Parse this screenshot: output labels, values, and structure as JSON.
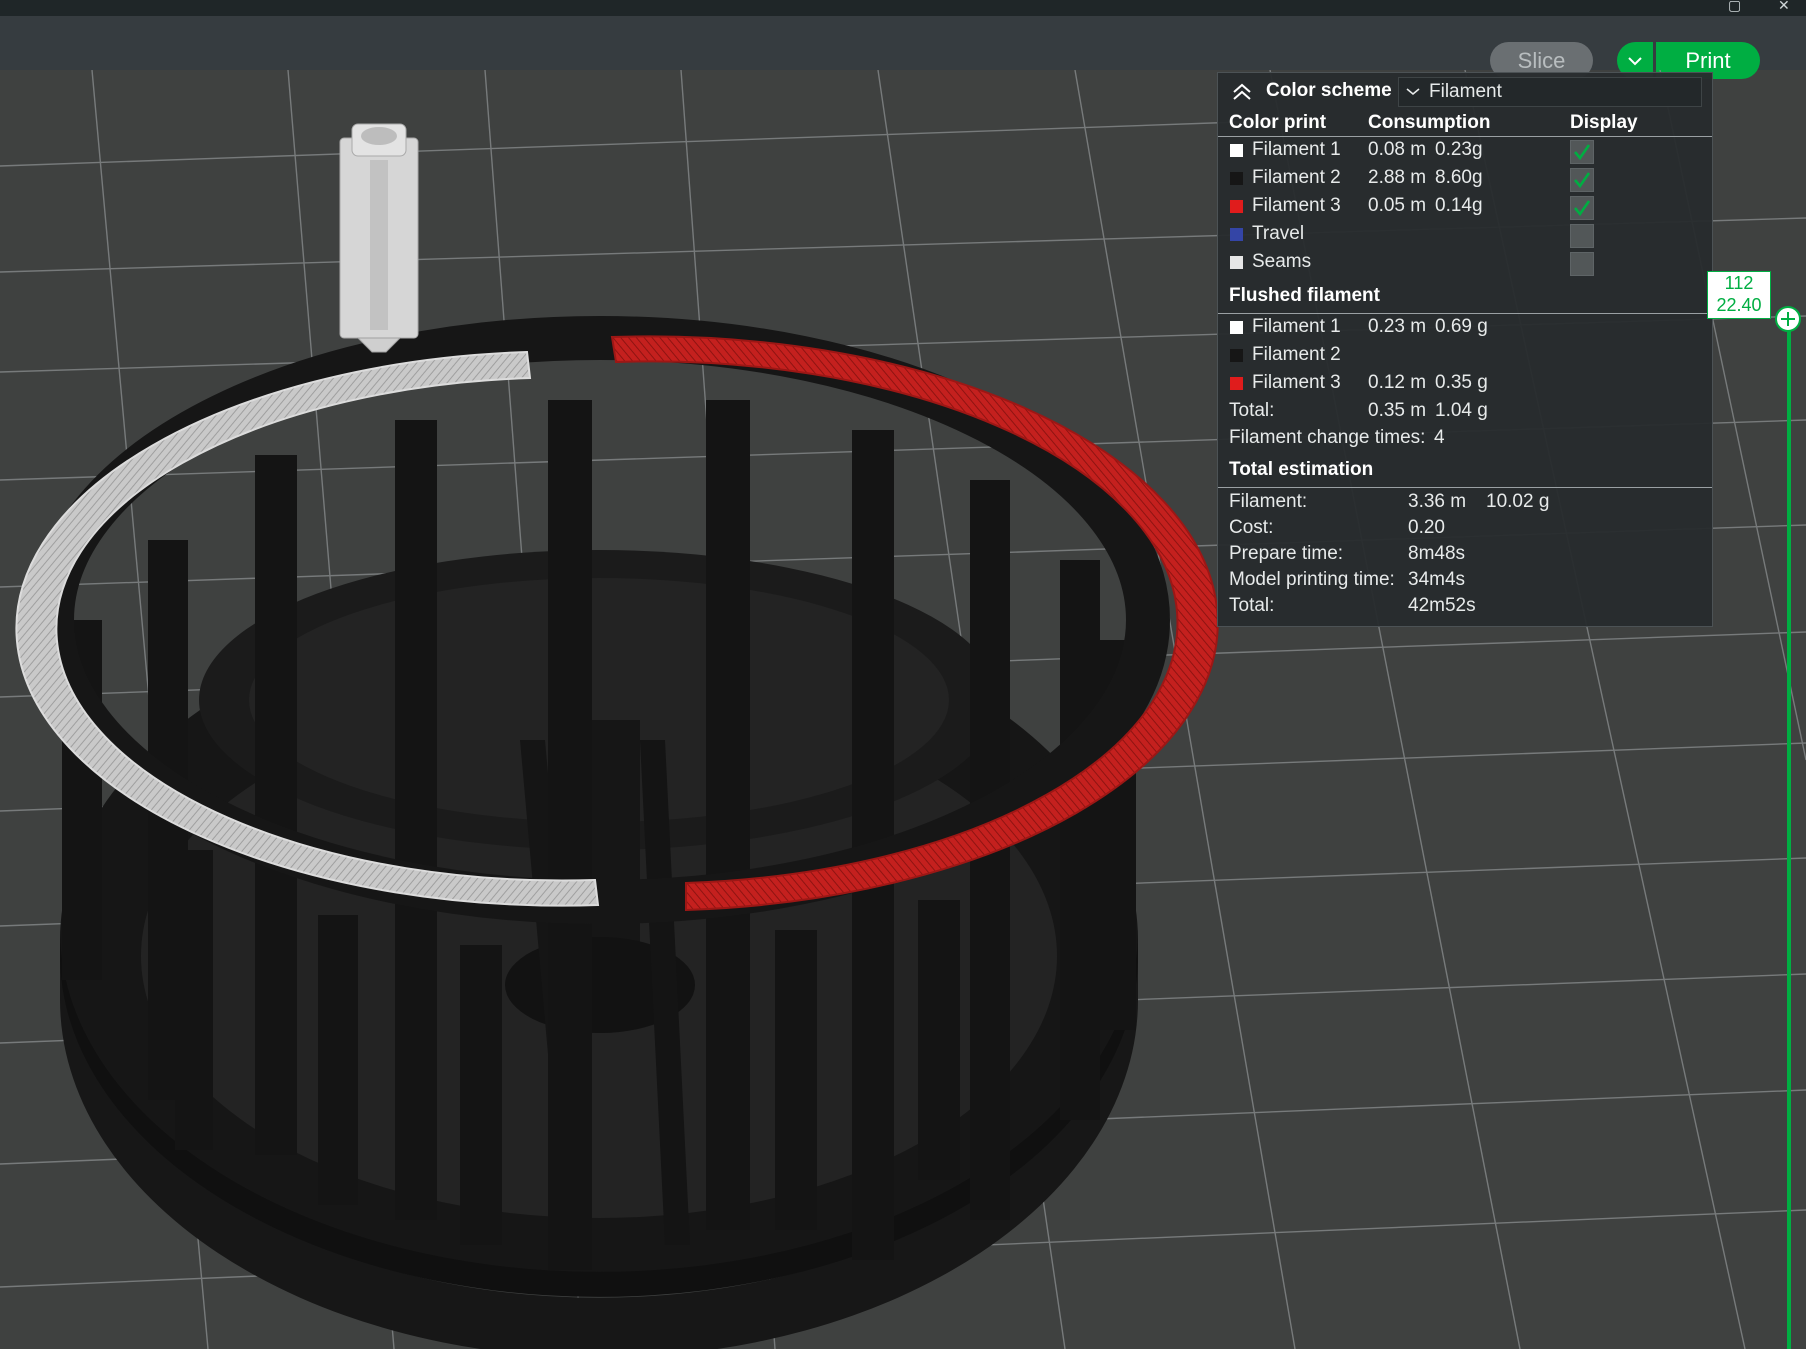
{
  "toolbar": {
    "slice_label": "Slice",
    "print_label": "Print",
    "print_dropdown_icon": "chevron-down-icon",
    "accent_color": "#00ae42"
  },
  "legend": {
    "collapse_icon": "double-chevron-up-icon",
    "title": "Color scheme",
    "scheme_value": "Filament",
    "columns": {
      "color_print": "Color print",
      "consumption": "Consumption",
      "display": "Display"
    },
    "color_print_items": [
      {
        "label": "Filament 1",
        "length": "0.08 m",
        "weight": "0.23g",
        "color": "#ffffff",
        "display": true
      },
      {
        "label": "Filament 2",
        "length": "2.88 m",
        "weight": "8.60g",
        "color": "#161616",
        "display": true
      },
      {
        "label": "Filament 3",
        "length": "0.05 m",
        "weight": "0.14g",
        "color": "#e01c1c",
        "display": true
      },
      {
        "label": "Travel",
        "length": "",
        "weight": "",
        "color": "#3445a6",
        "display": false
      },
      {
        "label": "Seams",
        "length": "",
        "weight": "",
        "color": "#e6e6e6",
        "display": false
      }
    ],
    "flushed": {
      "title": "Flushed filament",
      "items": [
        {
          "label": "Filament 1",
          "length": "0.23 m",
          "weight": "0.69 g",
          "color": "#ffffff"
        },
        {
          "label": "Filament 2",
          "length": "",
          "weight": "",
          "color": "#161616"
        },
        {
          "label": "Filament 3",
          "length": "0.12 m",
          "weight": "0.35 g",
          "color": "#e01c1c"
        }
      ],
      "total_label": "Total:",
      "total_length": "0.35 m",
      "total_weight": "1.04 g",
      "change_times_label": "Filament change times:",
      "change_times_value": "4"
    },
    "estimation": {
      "title": "Total estimation",
      "filament_label": "Filament:",
      "filament_length": "3.36 m",
      "filament_weight": "10.02 g",
      "cost_label": "Cost:",
      "cost_value": "0.20",
      "prepare_label": "Prepare time:",
      "prepare_value": "8m48s",
      "model_time_label": "Model printing time:",
      "model_time_value": "34m4s",
      "total_label": "Total:",
      "total_value": "42m52s"
    }
  },
  "layer_slider": {
    "layer": "112",
    "height": "22.40",
    "thumb_icon": "plus-circle-icon",
    "position": 1.0
  }
}
